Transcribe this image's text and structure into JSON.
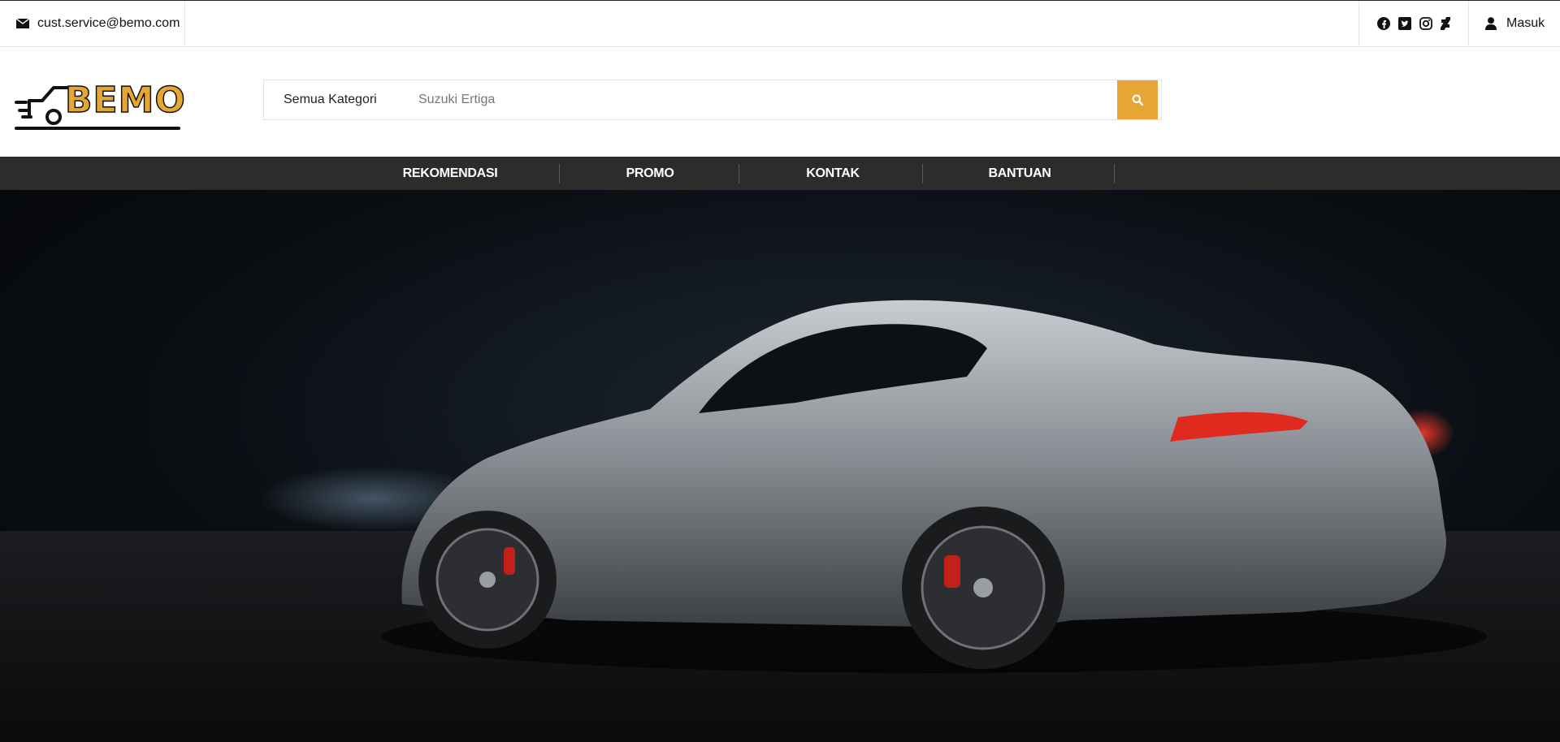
{
  "topbar": {
    "email": "cust.service@bemo.com",
    "login_label": "Masuk"
  },
  "icons": {
    "email": "envelope-icon",
    "social": [
      "facebook-icon",
      "twitter-icon",
      "instagram-icon",
      "deviantart-icon"
    ],
    "user": "user-icon",
    "search": "search-icon"
  },
  "logo": {
    "text": "BEMO"
  },
  "search": {
    "category": "Semua Kategori",
    "placeholder": "Suzuki Ertiga"
  },
  "nav": {
    "items": [
      "REKOMENDASI",
      "PROMO",
      "KONTAK",
      "BANTUAN"
    ]
  },
  "colors": {
    "accent": "#e6a633",
    "nav_bg": "#2c2c2c"
  }
}
